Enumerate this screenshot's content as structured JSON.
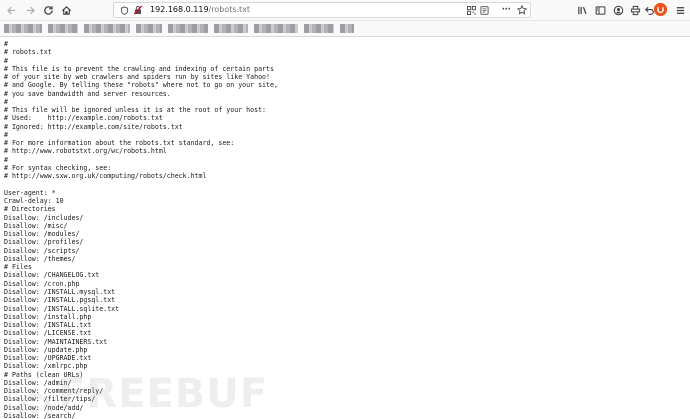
{
  "browser": {
    "url_domain": "192.168.0.119",
    "url_path": "/robots.txt",
    "menu_glyph": "···",
    "icons": {
      "back": "back-arrow-icon",
      "forward": "forward-arrow-icon",
      "reload": "reload-icon",
      "home": "home-icon",
      "site_info": "info-icon",
      "insecure": "insecure-lock-icon",
      "qr": "qr-code-icon",
      "reader": "reader-view-icon",
      "page_actions": "more-actions-icon",
      "bookmark": "star-icon",
      "library": "library-icon",
      "sidebar": "sidebar-icon",
      "account": "account-icon",
      "ext1": "extension-icon",
      "history_back": "undo-icon",
      "ublock": "ublock-icon",
      "menu": "hamburger-menu-icon"
    },
    "accent_color": "#e9541c"
  },
  "robots_txt": {
    "lines": [
      "#",
      "# robots.txt",
      "#",
      "# This file is to prevent the crawling and indexing of certain parts",
      "# of your site by web crawlers and spiders run by sites like Yahoo!",
      "# and Google. By telling these \"robots\" where not to go on your site,",
      "# you save bandwidth and server resources.",
      "#",
      "# This file will be ignored unless it is at the root of your host:",
      "# Used:    http://example.com/robots.txt",
      "# Ignored: http://example.com/site/robots.txt",
      "#",
      "# For more information about the robots.txt standard, see:",
      "# http://www.robotstxt.org/wc/robots.html",
      "#",
      "# For syntax checking, see:",
      "# http://www.sxw.org.uk/computing/robots/check.html",
      "",
      "User-agent: *",
      "Crawl-delay: 10",
      "# Directories",
      "Disallow: /includes/",
      "Disallow: /misc/",
      "Disallow: /modules/",
      "Disallow: /profiles/",
      "Disallow: /scripts/",
      "Disallow: /themes/",
      "# Files",
      "Disallow: /CHANGELOG.txt",
      "Disallow: /cron.php",
      "Disallow: /INSTALL.mysql.txt",
      "Disallow: /INSTALL.pgsql.txt",
      "Disallow: /INSTALL.sqlite.txt",
      "Disallow: /install.php",
      "Disallow: /INSTALL.txt",
      "Disallow: /LICENSE.txt",
      "Disallow: /MAINTAINERS.txt",
      "Disallow: /update.php",
      "Disallow: /UPGRADE.txt",
      "Disallow: /xmlrpc.php",
      "# Paths (clean URLs)",
      "Disallow: /admin/",
      "Disallow: /comment/reply/",
      "Disallow: /filter/tips/",
      "Disallow: /node/add/",
      "Disallow: /search/"
    ]
  },
  "watermark": {
    "text": "FREEBUF"
  }
}
